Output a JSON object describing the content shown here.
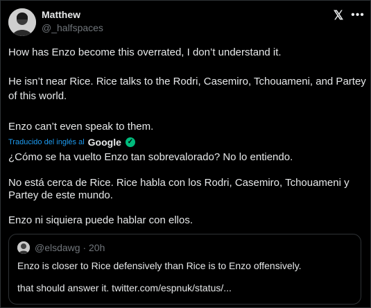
{
  "tweet": {
    "display_name": "Matthew",
    "handle": "@_halfspaces",
    "lines": [
      "How has Enzo become this overrated, I don’t understand it.",
      "He isn’t near Rice. Rice talks to the Rodri, Casemiro, Tchouameni, and Partey",
      "of this world.",
      "Enzo can’t even speak to them."
    ]
  },
  "translation": {
    "label": "Traducido del inglés al",
    "provider": "Google",
    "lines": [
      "¿Cómo se ha vuelto Enzo tan sobrevalorado? No lo entiendo.",
      "No está cerca de Rice. Rice habla con los Rodri, Casemiro, Tchouameni y",
      "Partey de este mundo.",
      "Enzo ni siquiera puede hablar con ellos."
    ]
  },
  "quote": {
    "handle_time": "@elsdawg · 20h",
    "lines": [
      "Enzo is closer to Rice defensively than Rice is to Enzo offensively.",
      "that should answer it. twitter.com/espnuk/status/..."
    ]
  },
  "icons": {
    "platform": "x-logo",
    "more": "more-icon",
    "verified": "check-badge-icon"
  }
}
